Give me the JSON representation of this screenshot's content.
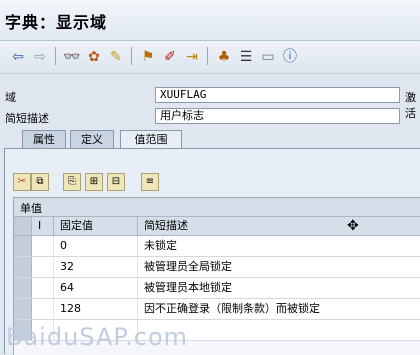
{
  "window": {
    "title": "字典：显示域"
  },
  "toolbar": {
    "icons": [
      "back-arrow-icon",
      "forward-arrow-icon",
      "glasses-icon",
      "other-object-icon",
      "display-change-icon",
      "check-icon",
      "activate-icon",
      "where-used-icon",
      "hierarchy-icon",
      "navigate-icon",
      "display-object-list-icon",
      "info-icon"
    ]
  },
  "fields": {
    "domain_label": "域",
    "domain_value": "XUUFLAG",
    "domain_status": "激活",
    "desc_label": "简短描述",
    "desc_value": "用户标志"
  },
  "tabs": [
    {
      "label": "属性"
    },
    {
      "label": "定义"
    },
    {
      "label": "值范围"
    }
  ],
  "table": {
    "section_title": "单值",
    "columns": [
      "I",
      "固定值",
      "简短描述"
    ],
    "rows": [
      {
        "fixed": "0",
        "desc": "未锁定"
      },
      {
        "fixed": "32",
        "desc": "被管理员全局锁定"
      },
      {
        "fixed": "64",
        "desc": "被管理员本地锁定"
      },
      {
        "fixed": "128",
        "desc": "因不正确登录（限制条款）而被锁定"
      }
    ]
  },
  "watermark": "BaiduSAP.com"
}
